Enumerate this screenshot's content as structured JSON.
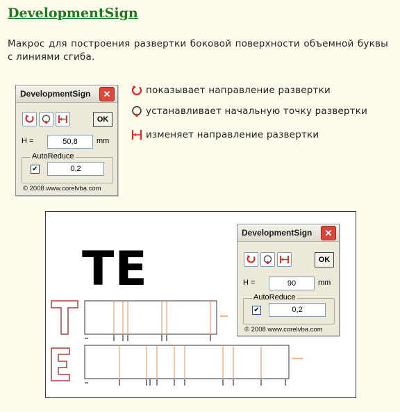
{
  "page": {
    "title": "DevelopmentSign",
    "description": "Макрос для построения развертки боковой поверхности объемной буквы с линиями сгиба."
  },
  "dialog_small": {
    "caption": "DevelopmentSign",
    "close": "✕",
    "ok_label": "OK",
    "h_label": "H =",
    "h_value": "50,8",
    "unit": "mm",
    "group_label": "AutoReduce",
    "checked": true,
    "reduce_value": "0,2",
    "copyright": "© 2008 www.corelvba.com"
  },
  "legend": [
    {
      "icon": "direction-show-icon",
      "text": "показывает направление развертки"
    },
    {
      "icon": "start-point-icon",
      "text": "устанавливает начальную точку развертки"
    },
    {
      "icon": "flip-direction-icon",
      "text": "изменяет направление развертки"
    }
  ],
  "example": {
    "big_text": "TE",
    "dialog": {
      "caption": "DevelopmentSign",
      "close": "✕",
      "ok_label": "OK",
      "h_label": "H =",
      "h_value": "90",
      "unit": "mm",
      "group_label": "AutoReduce",
      "checked": true,
      "reduce_value": "0,2",
      "copyright": "© 2008 www.corelvba.com"
    }
  },
  "colors": {
    "title": "#1e7a1e",
    "background": "#fdfbea",
    "fold_line": "#f0a070",
    "icon_red": "#d9302a"
  }
}
